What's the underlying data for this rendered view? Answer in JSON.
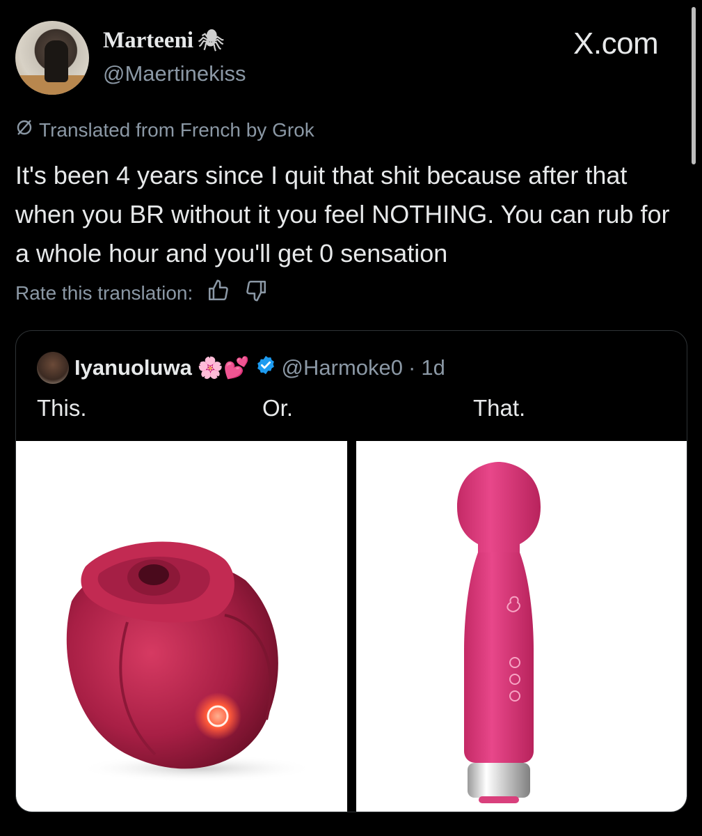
{
  "author": {
    "display_name": "Marteeni",
    "handle": "@Maertinekiss",
    "emoji": "🕷"
  },
  "brand": "X.com",
  "translation": {
    "label": "Translated from French by Grok",
    "rate_label": "Rate this translation:"
  },
  "tweet_text": "It's been 4 years since I quit that shit because after that when you BR without it you feel NOTHING. You can rub for a whole hour and you'll get 0 sensation",
  "quoted": {
    "display_name": "Iyanuoluwa",
    "emojis": "🌸💕",
    "handle": "@Harmoke0",
    "separator": "·",
    "time": "1d",
    "words": [
      "This.",
      "Or.",
      "That."
    ]
  },
  "colors": {
    "background": "#000000",
    "text_primary": "#e7e9ea",
    "text_secondary": "#8b98a5",
    "verified": "#1d9bf0",
    "toy_rose": "#b3214a",
    "toy_wand": "#e0427d"
  },
  "icons": [
    "grok-icon",
    "thumbs-up-icon",
    "thumbs-down-icon",
    "verified-badge-icon",
    "spider-icon"
  ]
}
